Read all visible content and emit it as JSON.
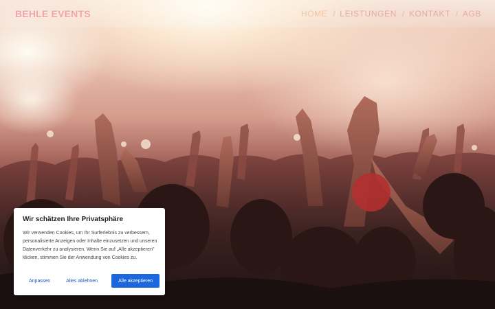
{
  "header": {
    "logo": "BEHLE EVENTS",
    "nav": [
      {
        "label": "HOME",
        "active": true
      },
      {
        "label": "LEISTUNGEN",
        "active": false
      },
      {
        "label": "KONTAKT",
        "active": false
      },
      {
        "label": "AGB",
        "active": false
      }
    ],
    "separator": "/"
  },
  "cookie_banner": {
    "title": "Wir schätzen Ihre Privatsphäre",
    "text": "Wir verwenden Cookies, um Ihr Surferlebnis zu verbessern, personalisierte Anzeigen oder Inhalte einzusetzen und unseren Datenverkehr zu analysieren. Wenn Sie auf „Alle akzeptieren\" klicken, stimmen Sie der Anwendung von Cookies zu.",
    "customize_label": "Anpassen",
    "reject_label": "Alles ablehnen",
    "accept_label": "Alle akzeptieren"
  },
  "colors": {
    "accent": "#1a67e0",
    "link": "#1a56c6",
    "logo": "#f2a3a3"
  }
}
